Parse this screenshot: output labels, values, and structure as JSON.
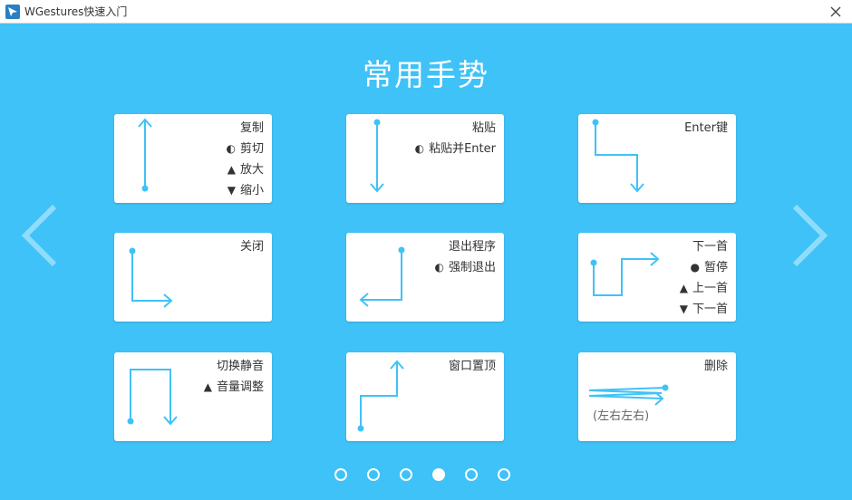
{
  "window": {
    "title": "WGestures快速入门",
    "app_icon": "wgestures-icon",
    "close_icon": "close-icon"
  },
  "page": {
    "title": "常用手势",
    "background": "#3fc2f7",
    "gesture_color": "#3fc2f7"
  },
  "cards": [
    {
      "id": "copy",
      "labels": [
        {
          "symbol": "",
          "text": "复制"
        },
        {
          "symbol": "◐",
          "text": "剪切"
        },
        {
          "symbol": "▲",
          "text": "放大"
        },
        {
          "symbol": "▼",
          "text": "缩小"
        }
      ]
    },
    {
      "id": "paste",
      "labels": [
        {
          "symbol": "",
          "text": "粘贴"
        },
        {
          "symbol": "◐",
          "text": "粘贴并Enter"
        }
      ]
    },
    {
      "id": "enter",
      "labels": [
        {
          "symbol": "",
          "text": "Enter键"
        }
      ]
    },
    {
      "id": "close",
      "labels": [
        {
          "symbol": "",
          "text": "关闭"
        }
      ]
    },
    {
      "id": "exit",
      "labels": [
        {
          "symbol": "",
          "text": "退出程序"
        },
        {
          "symbol": "◐",
          "text": "强制退出"
        }
      ]
    },
    {
      "id": "next",
      "labels": [
        {
          "symbol": "",
          "text": "下一首"
        },
        {
          "symbol": "●",
          "text": "暂停"
        },
        {
          "symbol": "▲",
          "text": "上一首"
        },
        {
          "symbol": "▼",
          "text": "下一首"
        }
      ]
    },
    {
      "id": "mute",
      "labels": [
        {
          "symbol": "",
          "text": "切换静音"
        },
        {
          "symbol": "▲",
          "text": "音量调整"
        }
      ]
    },
    {
      "id": "topmost",
      "labels": [
        {
          "symbol": "",
          "text": "窗口置顶"
        }
      ]
    },
    {
      "id": "delete",
      "labels": [
        {
          "symbol": "",
          "text": "删除"
        }
      ],
      "note": "(左右左右)"
    }
  ],
  "navigation": {
    "prev_icon": "chevron-left-icon",
    "next_icon": "chevron-right-icon"
  },
  "pagination": {
    "total": 6,
    "current": 4
  }
}
